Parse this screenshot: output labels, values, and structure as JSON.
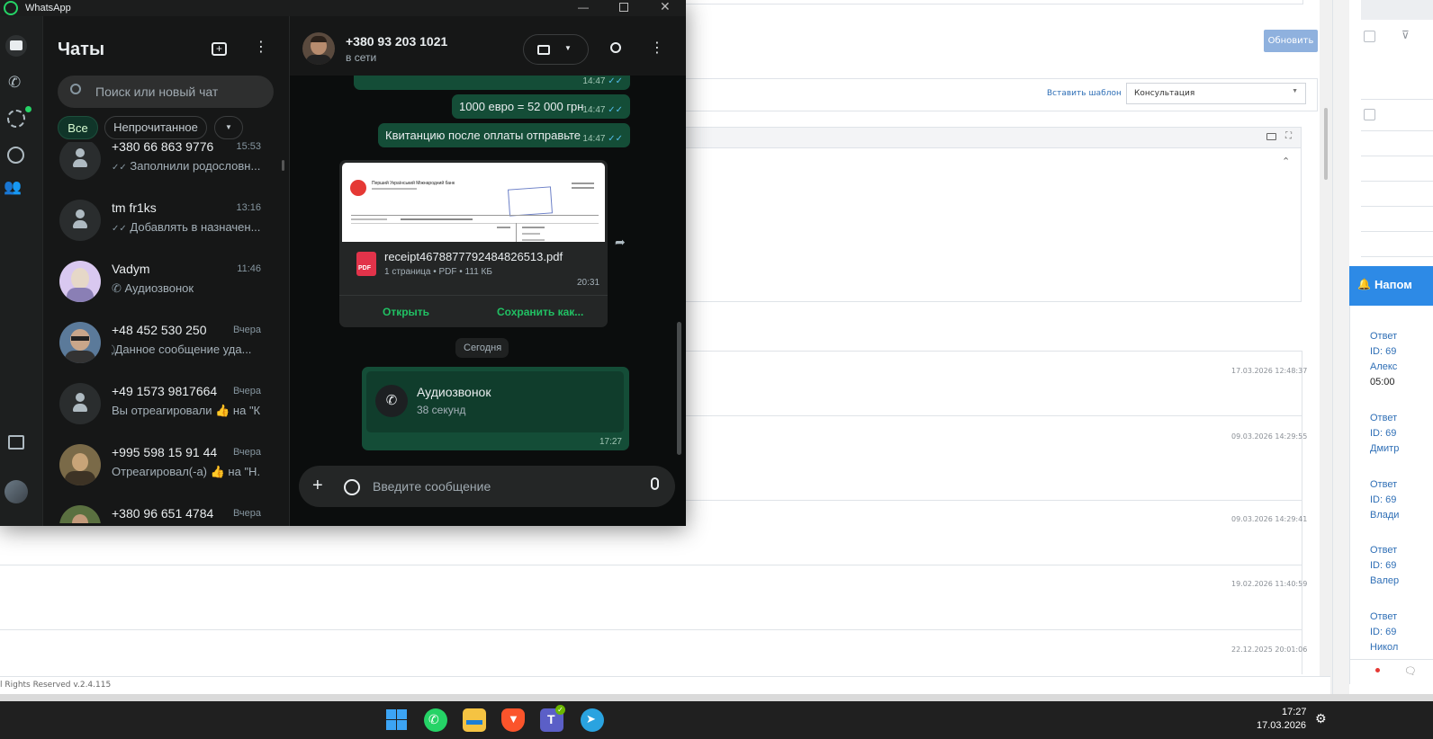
{
  "crm": {
    "refresh_button": "Обновить",
    "insert_template": "Вставить шаблон",
    "template_select": "Консультация",
    "timestamps": [
      "17.03.2026 12:48:37",
      "09.03.2026 14:29:55",
      "09.03.2026 14:29:41",
      "19.02.2026 11:40:59",
      "22.12.2025 20:01:06"
    ],
    "footer": "l Rights Reserved v.2.4.115",
    "reminder_title": "Напом",
    "reminders": [
      {
        "line1": "Ответ",
        "line2": "ID: 69",
        "line3": "Алекс",
        "line4": "05:00"
      },
      {
        "line1": "Ответ",
        "line2": "ID: 69",
        "line3": "Дмитр"
      },
      {
        "line1": "Ответ",
        "line2": "ID: 69",
        "line3": "Влади"
      },
      {
        "line1": "Ответ",
        "line2": "ID: 69",
        "line3": "Валер"
      },
      {
        "line1": "Ответ",
        "line2": "ID: 69",
        "line3": "Никол"
      }
    ]
  },
  "whatsapp": {
    "window_title": "WhatsApp",
    "chats_title": "Чаты",
    "search_placeholder": "Поиск или новый чат",
    "filters": [
      "Все",
      "Непрочитанное"
    ],
    "chats": [
      {
        "name": "+380 66 863 9776",
        "time": "15:53",
        "preview": "Заполнили родословн..."
      },
      {
        "name": "tm fr1ks",
        "time": "13:16",
        "preview": "Добавлять в назначен..."
      },
      {
        "name": "Vadym",
        "time": "11:46",
        "preview": "Аудиозвонок"
      },
      {
        "name": "+48 452 530 250",
        "time": "Вчера",
        "preview": "Данное сообщение уда..."
      },
      {
        "name": "+49 1573 9817664",
        "time": "Вчера",
        "preview": "Вы отреагировали 👍 на \"К"
      },
      {
        "name": "+995 598 15 91 44",
        "time": "Вчера",
        "preview": "Отреагировал(-а) 👍 на \"Н.."
      },
      {
        "name": "+380 96 651 4784",
        "time": "Вчера",
        "preview": ""
      }
    ],
    "contact": {
      "name": "+380 93 203 1021",
      "status": "в сети"
    },
    "messages": [
      {
        "text": "",
        "time": "14:47"
      },
      {
        "text": "1000 евро = 52 000 грн",
        "time": "14:47"
      },
      {
        "text": "Квитанцию после оплаты отправьте",
        "time": "14:47"
      }
    ],
    "document": {
      "filename": "receipt4678877792484826513.pdf",
      "meta": "1 страница • PDF • 111 КБ",
      "time": "20:31",
      "open": "Открыть",
      "save": "Сохранить как...",
      "pdf_label": "PDF",
      "bank": "Перший Український Міжнародний банк"
    },
    "date_divider": "Сегодня",
    "call": {
      "title": "Аудиозвонок",
      "duration": "38 секунд",
      "time": "17:27"
    },
    "input_placeholder": "Введите сообщение"
  },
  "taskbar": {
    "time": "17:27",
    "date": "17.03.2026"
  }
}
